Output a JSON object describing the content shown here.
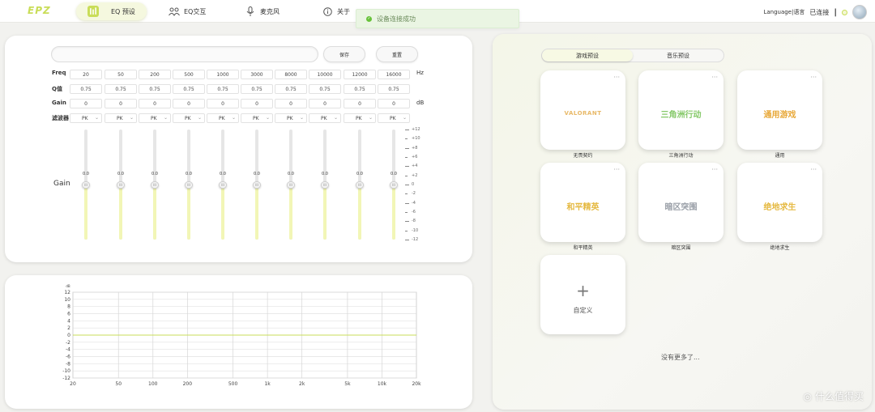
{
  "app": {
    "logo_text": "EPZ",
    "nav": [
      {
        "label": "EQ 预设",
        "icon": "eq-icon",
        "active": true
      },
      {
        "label": "EQ交互",
        "icon": "people-icon",
        "active": false
      },
      {
        "label": "麦克风",
        "icon": "microphone-icon",
        "active": false
      },
      {
        "label": "关于",
        "icon": "info-icon",
        "active": false
      }
    ],
    "toast": "设备连接成功",
    "language": "Language|语言",
    "connection": "已连接",
    "colors": {
      "accent": "#c9dd58",
      "accent_soft": "#f2f6b6",
      "graph_line": "#c9dd58"
    }
  },
  "eq": {
    "name_value": "",
    "save_label": "保存",
    "reset_label": "重置",
    "row_freq": "Freq",
    "row_q": "Q值",
    "row_gain": "Gain",
    "row_filter": "滤波器",
    "unit_hz": "Hz",
    "unit_db": "dB",
    "gain_side_label": "Gain",
    "freqs": [
      "20",
      "50",
      "200",
      "500",
      "1000",
      "3000",
      "8000",
      "10000",
      "12000",
      "16000"
    ],
    "q": [
      "0.75",
      "0.75",
      "0.75",
      "0.75",
      "0.75",
      "0.75",
      "0.75",
      "0.75",
      "0.75",
      "0.75"
    ],
    "gains": [
      "0",
      "0",
      "0",
      "0",
      "0",
      "0",
      "0",
      "0",
      "0",
      "0"
    ],
    "filters": [
      "PK",
      "PK",
      "PK",
      "PK",
      "PK",
      "PK",
      "PK",
      "PK",
      "PK",
      "PK"
    ],
    "slider_values": [
      "0.0",
      "0.0",
      "0.0",
      "0.0",
      "0.0",
      "0.0",
      "0.0",
      "0.0",
      "0.0",
      "0.0"
    ],
    "scale": [
      "+12",
      "+10",
      "+8",
      "+6",
      "+4",
      "+2",
      "0",
      "-2",
      "-4",
      "-6",
      "-8",
      "-10",
      "-12"
    ],
    "knob_glyph": "III"
  },
  "chart_data": {
    "type": "line",
    "title": "",
    "ylabel": "dB",
    "xlabel": "",
    "x_scale": "log",
    "xlim": [
      20,
      20000
    ],
    "ylim": [
      -12,
      12
    ],
    "yticks": [
      "12",
      "10",
      "8",
      "6",
      "4",
      "2",
      "0",
      "-2",
      "-4",
      "-6",
      "-8",
      "-10",
      "-12"
    ],
    "xticks": [
      "20",
      "50",
      "100",
      "200",
      "500",
      "1k",
      "2k",
      "5k",
      "10k",
      "20k"
    ],
    "xtick_values": [
      20,
      50,
      100,
      200,
      500,
      1000,
      2000,
      5000,
      10000,
      20000
    ],
    "grid": true,
    "series": [
      {
        "x": [
          20,
          20000
        ],
        "values": [
          0,
          0
        ]
      }
    ]
  },
  "presets": {
    "tabs": [
      {
        "label": "游戏预设",
        "active": true
      },
      {
        "label": "音乐预设",
        "active": false
      }
    ],
    "menu_glyph": "···",
    "cards": [
      {
        "label": "无畏契约",
        "logo_text": "VALORANT",
        "logo_color": "#e8b968"
      },
      {
        "label": "三角洲行动",
        "logo_text": "三角洲行动",
        "logo_color": "#86c96a"
      },
      {
        "label": "通用",
        "logo_text": "通用游戏",
        "logo_color": "#e8a838"
      },
      {
        "label": "和平精英",
        "logo_text": "和平精英",
        "logo_color": "#e5b941"
      },
      {
        "label": "暗区突围",
        "logo_text": "暗区突围",
        "logo_color": "#9aa0a8"
      },
      {
        "label": "绝地求生",
        "logo_text": "绝地求生",
        "logo_color": "#e5b941"
      }
    ],
    "add_glyph": "+",
    "add_label": "自定义",
    "no_more": "没有更多了...",
    "watermark": "什么值得买"
  }
}
